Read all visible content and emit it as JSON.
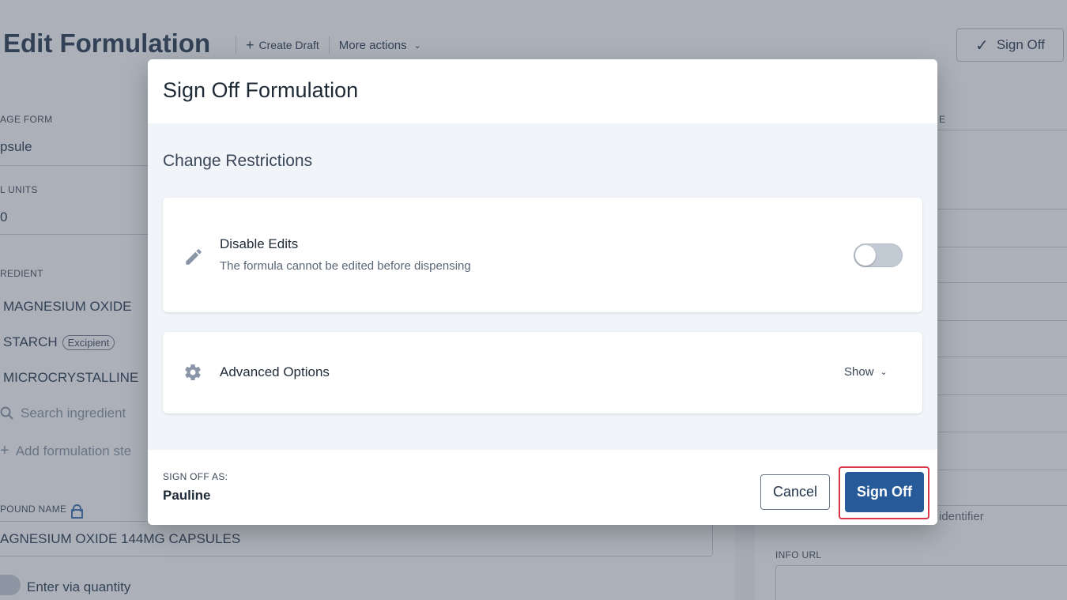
{
  "page": {
    "title": "Edit Formulation",
    "create_draft": "Create Draft",
    "more_actions": "More actions",
    "sign_off_label": "Sign Off",
    "left": {
      "dosage_form_label": "AGE FORM",
      "dosage_form_value": "psule",
      "total_units_label": "L UNITS",
      "total_units_value": "0",
      "ingredient_label": "REDIENT",
      "ingredients": [
        {
          "name": "MAGNESIUM OXIDE",
          "tag": ""
        },
        {
          "name": "STARCH",
          "tag": "Excipient"
        },
        {
          "name": "MICROCRYSTALLINE",
          "tag": ""
        }
      ],
      "search_placeholder": "Search ingredient",
      "add_step": "Add formulation ste",
      "compound_name_label": "POUND NAME",
      "compound_name_value": "AGNESIUM OXIDE 144MG CAPSULES",
      "enter_via_quantity": "Enter via quantity"
    },
    "right": {
      "partial_label": "E",
      "identifier_text": "identifier",
      "info_url_label": "INFO URL"
    }
  },
  "modal": {
    "title": "Sign Off Formulation",
    "section_title": "Change Restrictions",
    "disable_edits": {
      "title": "Disable Edits",
      "description": "The formula cannot be edited before dispensing",
      "enabled": false
    },
    "advanced_options": {
      "title": "Advanced Options",
      "show_label": "Show"
    },
    "footer": {
      "sign_off_as_label": "SIGN OFF AS:",
      "user": "Pauline",
      "cancel_label": "Cancel",
      "sign_off_label": "Sign Off"
    }
  },
  "colors": {
    "primary": "#265a98",
    "highlight": "#d9364a",
    "overlay": "#465264"
  }
}
